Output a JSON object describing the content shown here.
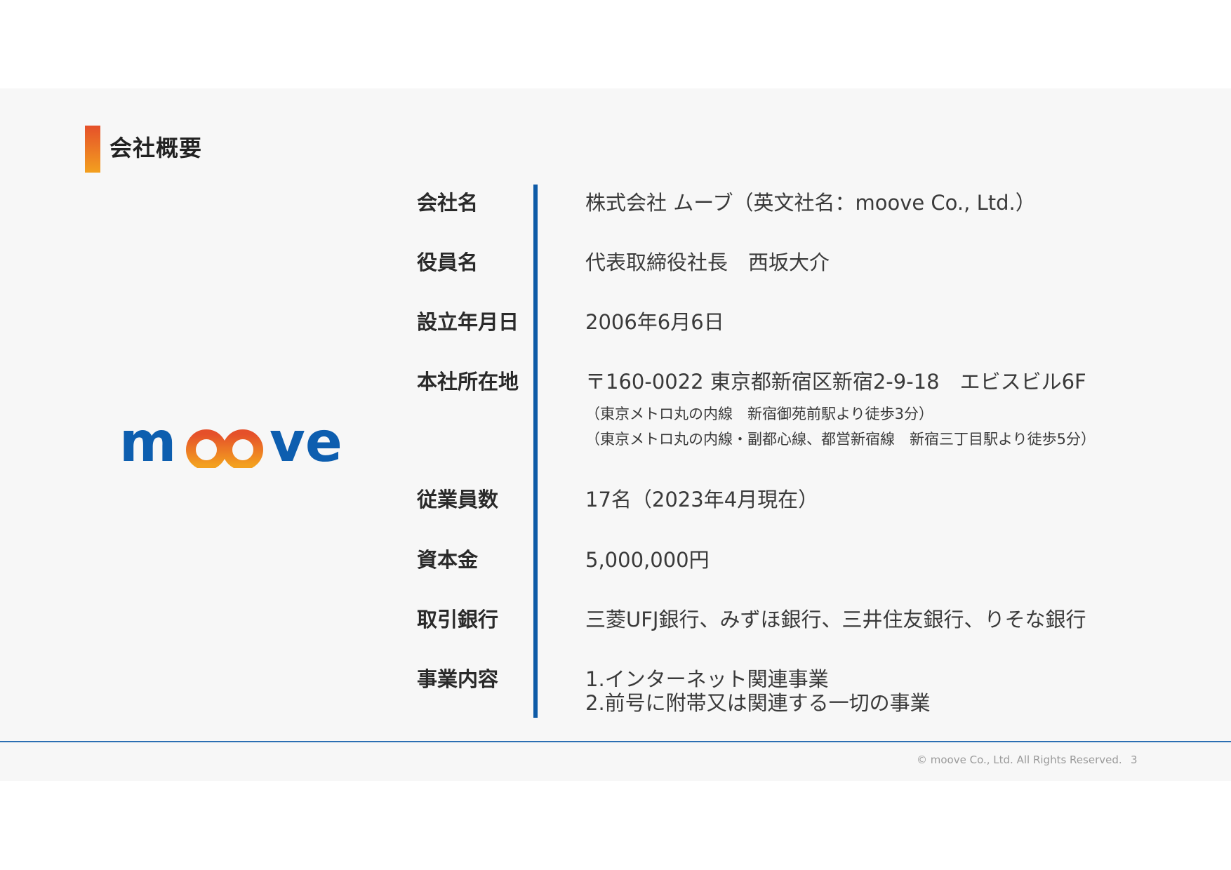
{
  "header": {
    "title": "会社概要"
  },
  "logo": {
    "text_left": "m",
    "text_right": "ve"
  },
  "rows": [
    {
      "label": "会社名",
      "value": "株式会社 ムーブ（英文社名：moove Co., Ltd.）"
    },
    {
      "label": "役員名",
      "value": "代表取締役社長　西坂大介"
    },
    {
      "label": "設立年月日",
      "value": "2006年6月6日"
    },
    {
      "label": "本社所在地",
      "value": "〒160-0022 東京都新宿区新宿2-9-18　エビスビル6F",
      "notes": [
        "（東京メトロ丸の内線　新宿御苑前駅より徒歩3分）",
        "（東京メトロ丸の内線・副都心線、都営新宿線　新宿三丁目駅より徒歩5分）"
      ]
    },
    {
      "label": "従業員数",
      "value": "17名（2023年4月現在）"
    },
    {
      "label": "資本金",
      "value": "5,000,000円"
    },
    {
      "label": "取引銀行",
      "value": "三菱UFJ銀行、みずほ銀行、三井住友銀行、りそな銀行"
    },
    {
      "label": "事業内容",
      "value": "1.インターネット関連事業",
      "value2": "2.前号に附帯又は関連する一切の事業"
    }
  ],
  "footer": {
    "copyright": "© moove Co., Ltd. All Rights Reserved.",
    "page": "3"
  },
  "colors": {
    "accent_blue": "#0e5ba7",
    "accent_orange": "#e5502a",
    "accent_yellow": "#f3a01f"
  }
}
